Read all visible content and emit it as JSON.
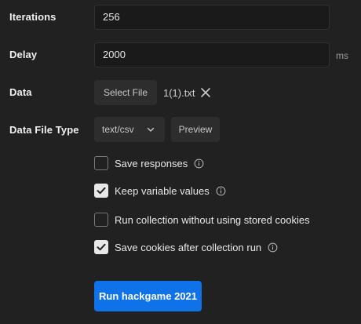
{
  "iterations": {
    "label": "Iterations",
    "value": "256"
  },
  "delay": {
    "label": "Delay",
    "value": "2000",
    "unit": "ms"
  },
  "data_file": {
    "label": "Data",
    "select_button": "Select File",
    "file_name": "1(1).txt"
  },
  "data_file_type": {
    "label": "Data File Type",
    "selected": "text/csv",
    "preview_button": "Preview"
  },
  "options": [
    {
      "label": "Save responses",
      "checked": false,
      "info": true
    },
    {
      "label": "Keep variable values",
      "checked": true,
      "info": true
    },
    {
      "label": "Run collection without using stored cookies",
      "checked": false,
      "info": false
    },
    {
      "label": "Save cookies after collection run",
      "checked": true,
      "info": true
    }
  ],
  "run_button": {
    "label": "Run hackgame 2021"
  },
  "colors": {
    "background": "#212121",
    "accent": "#0f72e8",
    "checkbox_checked": "#e8e8e8"
  }
}
